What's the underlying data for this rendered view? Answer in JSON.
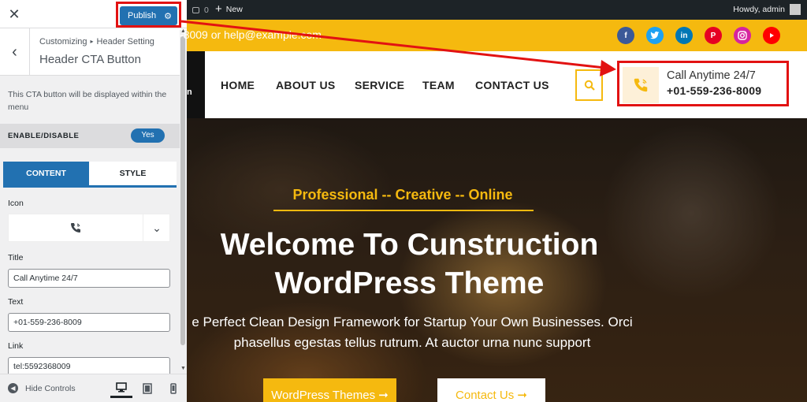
{
  "sidebar": {
    "close_icon": "close-icon",
    "publish_label": "Publish",
    "breadcrumb_root": "Customizing",
    "breadcrumb_section": "Header Setting",
    "section_title": "Header CTA Button",
    "description": "This CTA button will be displayed within the menu",
    "enable_label": "ENABLE/DISABLE",
    "enable_value": "Yes",
    "tabs": [
      {
        "label": "CONTENT",
        "active": true
      },
      {
        "label": "STYLE",
        "active": false
      }
    ],
    "icon_label": "Icon",
    "icon_selected": "phone-volume-icon",
    "title_label": "Title",
    "title_value": "Call Anytime 24/7",
    "text_label": "Text",
    "text_value": "+01-559-236-8009",
    "link_label": "Link",
    "link_value": "tel:5592368009",
    "hide_controls": "Hide Controls",
    "devices": [
      "desktop",
      "tablet",
      "mobile"
    ]
  },
  "adminbar": {
    "comments_count": "0",
    "new_label": "New",
    "howdy": "Howdy, admin"
  },
  "site": {
    "topbar_contact": "-8009 or help@example.com",
    "socials": [
      "facebook",
      "twitter",
      "linkedin",
      "pinterest",
      "instagram",
      "youtube"
    ],
    "nav": [
      "HOME",
      "ABOUT US",
      "SERVICE",
      "TEAM",
      "CONTACT US"
    ],
    "cta_title": "Call Anytime 24/7",
    "cta_phone": "+01-559-236-8009",
    "hero_kicker": "Professional -- Creative -- Online",
    "hero_title_line1": "Welcome To Cunstruction",
    "hero_title_line2": "WordPress Theme",
    "hero_text_line1": "e Perfect Clean Design Framework for Startup Your Own Businesses. Orci",
    "hero_text_line2": "phasellus egestas tellus rutrum. At auctor urna nunc support",
    "hero_btn1": "WordPress Themes ➞",
    "hero_btn2": "Contact Us ➞"
  },
  "colors": {
    "accent": "#f5b90f",
    "wp_blue": "#2271b1",
    "annotation_red": "#e21212",
    "facebook": "#3b5998",
    "twitter": "#1da1f2",
    "linkedin": "#0077b5",
    "pinterest": "#e60023",
    "instagram": "#d6249f",
    "youtube": "#ff0000"
  }
}
